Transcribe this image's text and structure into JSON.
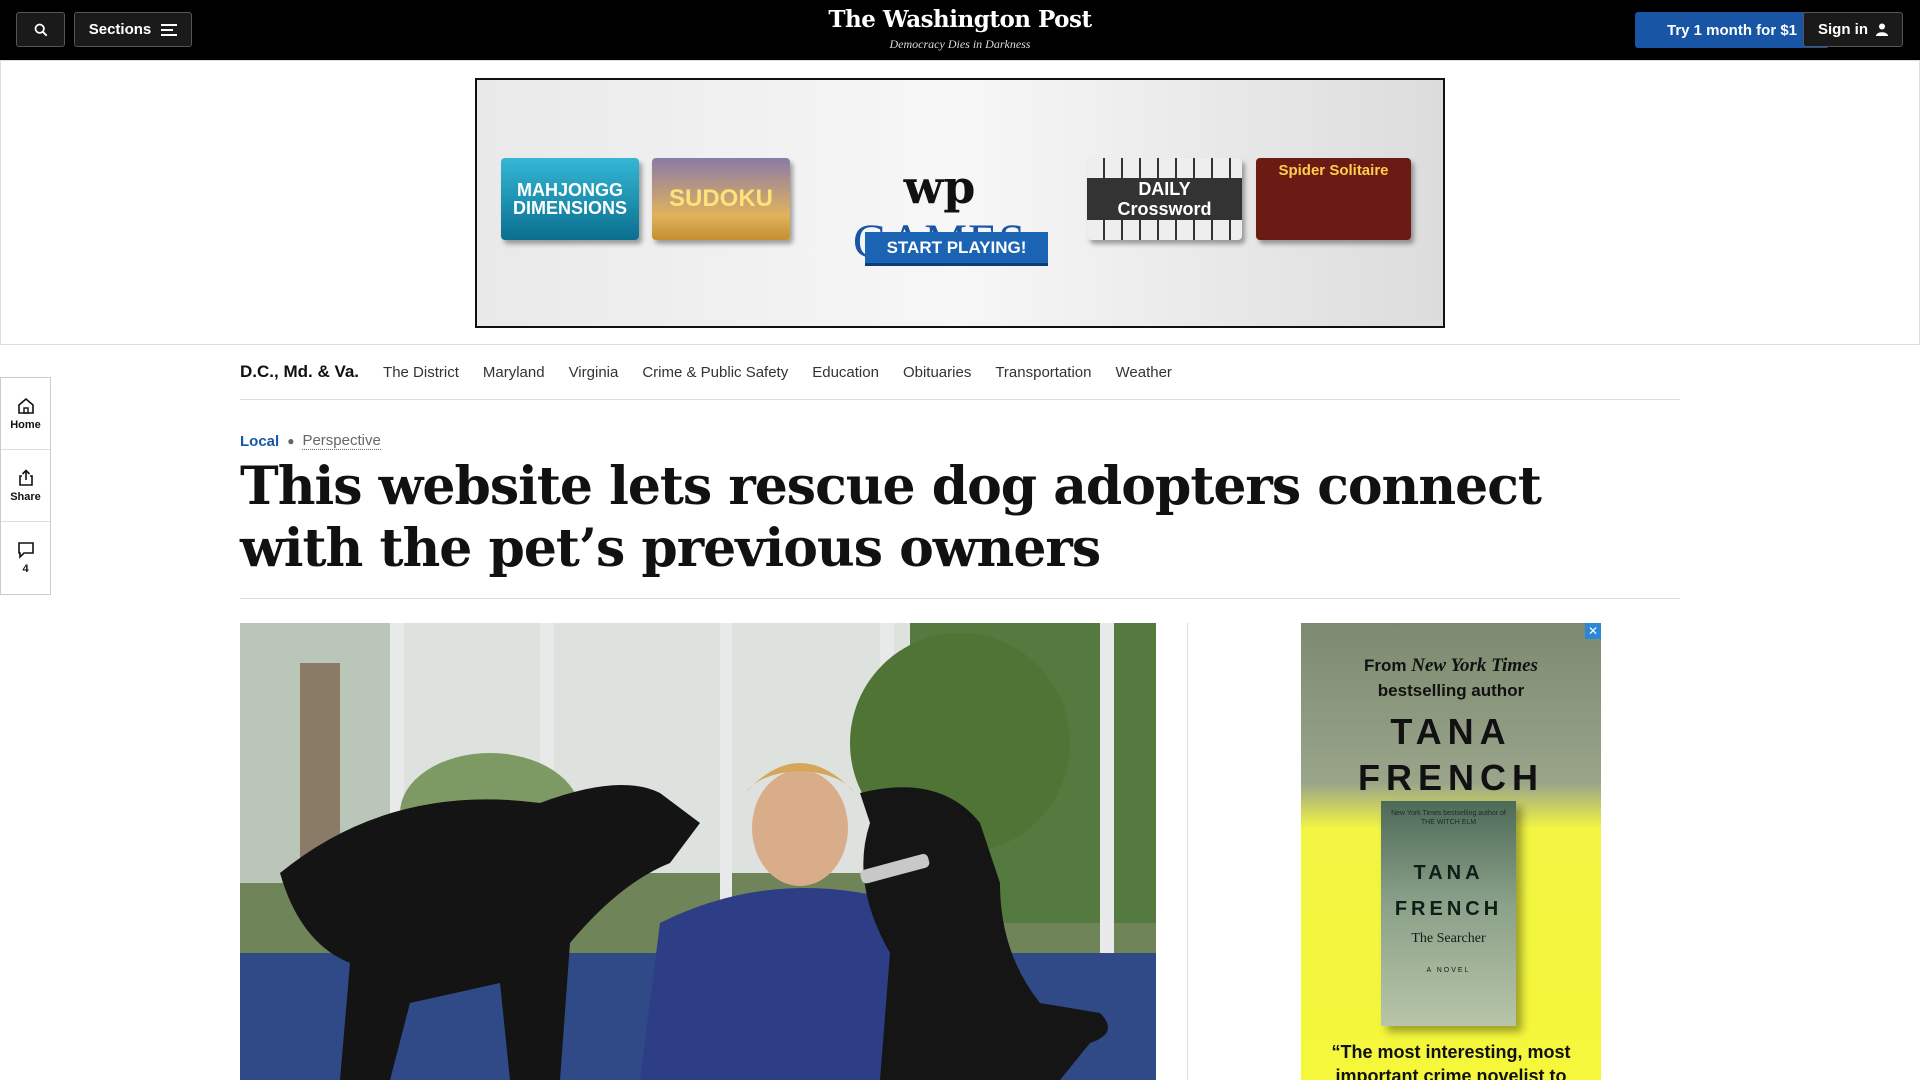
{
  "header": {
    "sections_label": "Sections",
    "logo": "The Washington Post",
    "tagline": "Democracy Dies in Darkness",
    "subscribe_label": "Try 1 month for $1",
    "signin_label": "Sign in"
  },
  "top_ad": {
    "tiles": [
      "MAHJONGG DIMENSIONS",
      "SUDOKU",
      "DAILY Crossword",
      "Spider Solitaire"
    ],
    "brand_wp": "wp",
    "brand_games": "GAMES",
    "cta": "START PLAYING!"
  },
  "rail": {
    "home_label": "Home",
    "share_label": "Share",
    "comments_count": "4"
  },
  "section_nav": {
    "title": "D.C., Md. & Va.",
    "items": [
      "The District",
      "Maryland",
      "Virginia",
      "Crime & Public Safety",
      "Education",
      "Obituaries",
      "Transportation",
      "Weather"
    ]
  },
  "article": {
    "kicker_section": "Local",
    "kicker_label": "Perspective",
    "headline": "This website lets rescue dog adopters connect with the pet’s previous owners"
  },
  "side_ad": {
    "close": "✕",
    "from_line1": "From",
    "from_italic": "New York Times",
    "from_line2": "bestselling author",
    "author_line1": "TANA",
    "author_line2": "FRENCH",
    "book_top_line1": "New York Times bestselling author of",
    "book_top_line2": "THE WITCH ELM",
    "book_author_line1": "TANA",
    "book_author_line2": "FRENCH",
    "book_title": "The Searcher",
    "book_novel": "A NOVEL",
    "quote": "“The most interesting, most important crime novelist to"
  },
  "colors": {
    "topbar": "#000000",
    "accent_blue": "#1955a5",
    "ad_yellow": "#f4f73a"
  }
}
